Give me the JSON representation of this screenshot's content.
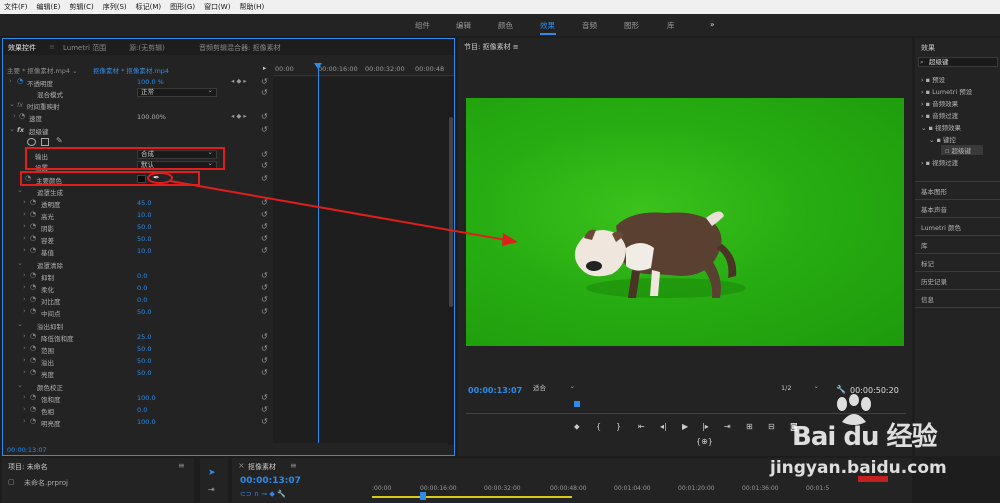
{
  "menubar": [
    "文件(F)",
    "编辑(E)",
    "剪辑(C)",
    "序列(S)",
    "标记(M)",
    "图形(G)",
    "窗口(W)",
    "帮助(H)"
  ],
  "workspace": {
    "tabs": [
      "组件",
      "编辑",
      "颜色",
      "效果",
      "音频",
      "图形",
      "库"
    ],
    "active": "效果",
    "more": "»"
  },
  "effect_controls": {
    "tabs": [
      "效果控件",
      "Lumetri 范围",
      "源:(无剪辑)",
      "音频剪辑混合器: 抠像素材"
    ],
    "source_line": "主要 * 抠像素材.mp4 ⌄",
    "clip_link": "抠像素材 * 抠像素材.mp4",
    "ruler": [
      "00:00",
      "00:00:16:00",
      "00:00:32:00",
      "00:00:48"
    ],
    "rows": {
      "opacity": "不透明度",
      "opacity_val": "100.0 %",
      "blend": "混合模式",
      "blend_val": "正常",
      "timeremap": "时间重映射",
      "speed": "速度",
      "speed_val": "100.00%",
      "ultrakey": "超级键",
      "output": "输出",
      "output_val": "合成",
      "setting": "设置",
      "setting_val": "默认",
      "keycolor": "主要颜色",
      "matte_gen": "遮罩生成",
      "transparency": "透明度",
      "transparency_val": "45.0",
      "highlight": "高光",
      "highlight_val": "10.0",
      "shadow": "阴影",
      "shadow_val": "50.0",
      "tolerance": "容差",
      "tolerance_val": "50.0",
      "pedestal": "基值",
      "pedestal_val": "10.0",
      "matte_cleanup": "遮罩清除",
      "choke": "抑制",
      "choke_val": "0.0",
      "soften": "柔化",
      "soften_val": "0.0",
      "contrast": "对比度",
      "contrast_val": "0.0",
      "midpoint": "中间点",
      "midpoint_val": "50.0",
      "spill": "溢出抑制",
      "desat": "降低饱和度",
      "desat_val": "25.0",
      "range": "范围",
      "range_val": "50.0",
      "spill2": "溢出",
      "spill2_val": "50.0",
      "luma": "亮度",
      "luma_val": "50.0",
      "colorcorr": "颜色校正",
      "saturation": "饱和度",
      "saturation_val": "100.0",
      "hue": "色相",
      "hue_val": "0.0",
      "lightness": "明亮度",
      "lightness_val": "100.0"
    },
    "time": "00:00:13:07"
  },
  "program": {
    "title": "节目: 抠像素材 ≡",
    "timecode": "00:00:13:07",
    "fit": "适合",
    "resolution": "1/2",
    "duration": "00:00:50:20"
  },
  "effects": {
    "title": "效果",
    "search": "超级键",
    "tree": [
      "预设",
      "Lumetri 预设",
      "音频效果",
      "音频过渡",
      "视频效果",
      "键控",
      "超级键",
      "视频过渡"
    ],
    "panels": [
      "基本图形",
      "基本声音",
      "Lumetri 颜色",
      "库",
      "标记",
      "历史记录",
      "信息"
    ]
  },
  "bottom": {
    "project_title": "项目: 未命名",
    "project_file": "未命名.prproj",
    "seq_tab": "抠像素材",
    "seq_time": "00:00:13:07",
    "seq_ruler": [
      ":00:00",
      "00:00:16:00",
      "00:00:32:00",
      "00:00:48:00",
      "00:01:04:00",
      "00:01:20:00",
      "00:01:36:00",
      "00:01:5"
    ]
  },
  "watermark": {
    "brand": "Bai du 经验",
    "url": "jingyan.baidu.com"
  },
  "colors": {
    "accent": "#2d8ceb",
    "highlight_red": "#e01e1e",
    "green_screen": "#27ad12"
  }
}
